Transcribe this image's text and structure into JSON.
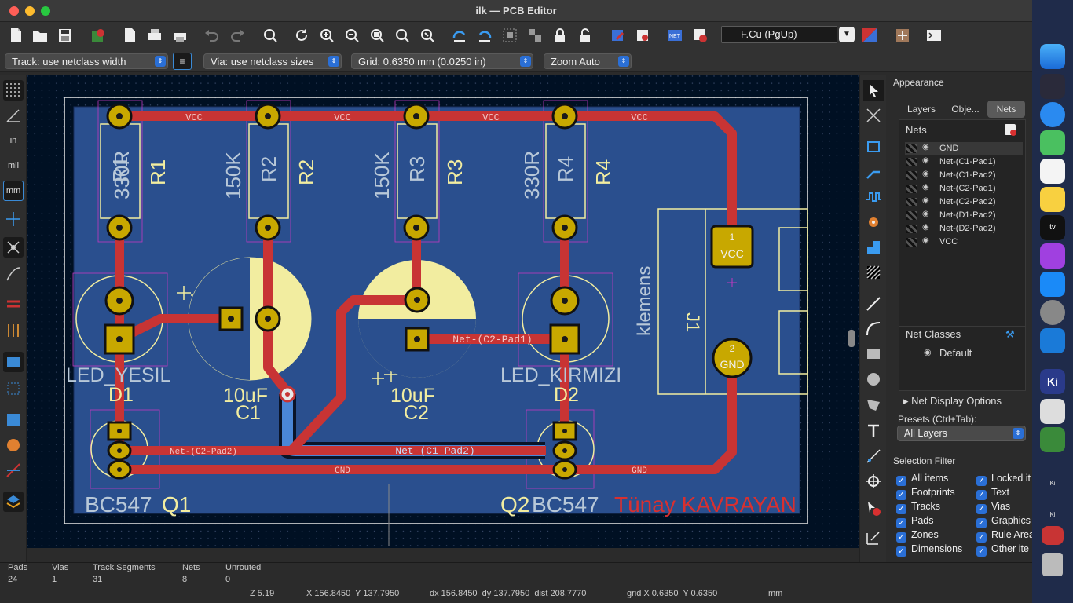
{
  "window": {
    "title": "ilk — PCB Editor"
  },
  "toolbar2": {
    "track": "Track: use netclass width",
    "via": "Via: use netclass sizes",
    "grid": "Grid: 0.6350 mm (0.0250 in)",
    "zoom": "Zoom Auto",
    "layer": "F.Cu (PgUp)"
  },
  "left_toolbar": {
    "in": "in",
    "mil": "mil",
    "mm": "mm"
  },
  "board": {
    "colors": {
      "copper_front": "#c83434",
      "copper_back": "#4a86d6",
      "zone": "#2a4f8e",
      "silk": "#f2eda0",
      "pad": "#c8a800"
    },
    "net_labels": {
      "vcc": "VCC",
      "gnd": "GND",
      "c2pad1": "Net-(C2-Pad1)",
      "c2pad2": "Net-(C2-Pad2)",
      "c1pad2": "Net-(C1-Pad2)"
    },
    "refs": {
      "r1": "R1",
      "r2": "R2",
      "r3": "R3",
      "r4": "R4",
      "v330a": "330R",
      "v150a": "150K",
      "v150b": "150K",
      "v330b": "330R",
      "led1": "LED_YESIL",
      "d1": "D1",
      "led2": "LED_KIRMIZI",
      "d2": "D2",
      "c1v": "10uF",
      "c1": "C1",
      "c2v": "10uF",
      "c2": "C2",
      "q1v": "BC547",
      "q1": "Q1",
      "q2": "Q2",
      "q2v": "BC547",
      "author": "Tünay KAVRAYAN",
      "klemens": "klemens",
      "j1": "J1",
      "pad_vcc": "VCC",
      "pad_gnd": "GND",
      "pad1": "1",
      "pad2": "2"
    }
  },
  "panel": {
    "title": "Appearance",
    "tabs": [
      "Layers",
      "Obje...",
      "Nets"
    ],
    "nets_header": "Nets",
    "nets": [
      "GND",
      "Net-(C1-Pad1)",
      "Net-(C1-Pad2)",
      "Net-(C2-Pad1)",
      "Net-(C2-Pad2)",
      "Net-(D1-Pad2)",
      "Net-(D2-Pad2)",
      "VCC"
    ],
    "net_classes": "Net Classes",
    "default_class": "Default",
    "net_display": "Net Display Options",
    "presets_label": "Presets (Ctrl+Tab):",
    "presets_value": "All Layers",
    "selection_filter": "Selection Filter",
    "filters_left": [
      "All items",
      "Footprints",
      "Tracks",
      "Pads",
      "Zones",
      "Dimensions"
    ],
    "filters_right": [
      "Locked it",
      "Text",
      "Vias",
      "Graphics",
      "Rule Area",
      "Other ite"
    ]
  },
  "status": {
    "labels": [
      "Pads",
      "Vias",
      "Track Segments",
      "Nets",
      "Unrouted"
    ],
    "values": [
      "24",
      "1",
      "31",
      "8",
      "0"
    ],
    "z": "Z 5.19",
    "xy": "X 156.8450  Y 137.7950",
    "dxy": "dx 156.8450  dy 137.7950  dist 208.7770",
    "grid": "grid X 0.6350  Y 0.6350",
    "units": "mm"
  }
}
